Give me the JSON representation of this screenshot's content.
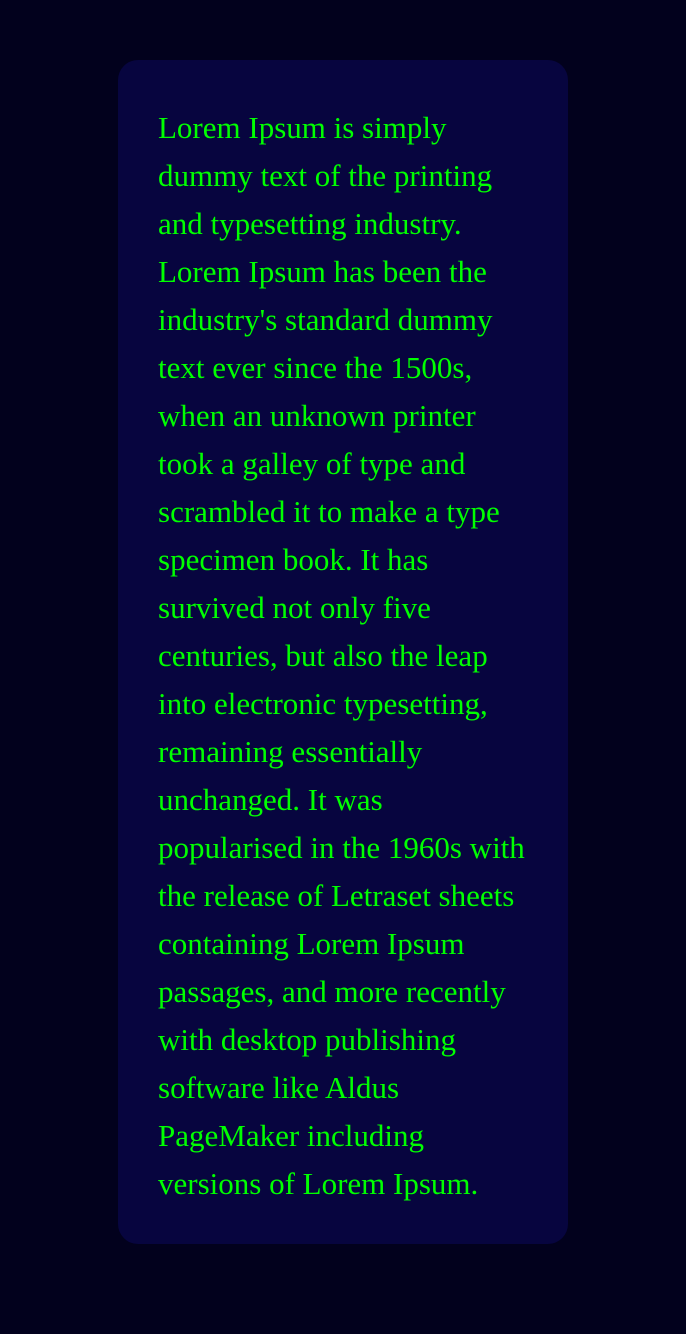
{
  "card": {
    "text": "Lorem Ipsum is simply dummy text of the printing and typesetting industry. Lorem Ipsum has been the industry's standard dummy text ever since the 1500s, when an unknown printer took a galley of type and scrambled it to make a type specimen book. It has survived not only five centuries, but also the leap into electronic typesetting, remaining essentially unchanged. It was popularised in the 1960s with the release of Letraset sheets containing Lorem Ipsum passages, and more recently with desktop publishing software like Aldus PageMaker including versions of Lorem Ipsum."
  },
  "colors": {
    "page_background": "#02011d",
    "card_background": "#07053f",
    "text": "#00ff00"
  }
}
